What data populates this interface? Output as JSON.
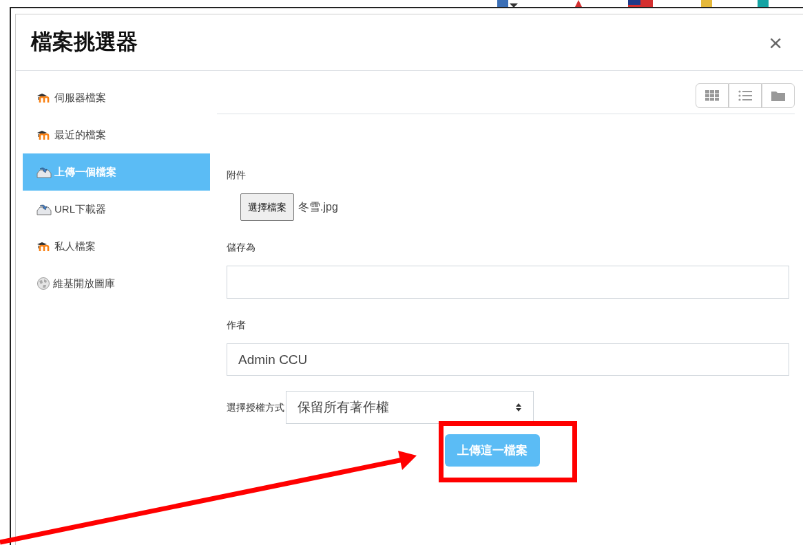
{
  "dialog": {
    "title": "檔案挑選器",
    "close": "×"
  },
  "sidebar": {
    "items": [
      {
        "label": "伺服器檔案",
        "kind": "moodle",
        "selected": false
      },
      {
        "label": "最近的檔案",
        "kind": "moodle",
        "selected": false
      },
      {
        "label": "上傳一個檔案",
        "kind": "upload",
        "selected": true
      },
      {
        "label": "URL下載器",
        "kind": "upload",
        "selected": false
      },
      {
        "label": "私人檔案",
        "kind": "moodle",
        "selected": false
      },
      {
        "label": "維基開放圖庫",
        "kind": "wiki",
        "selected": false
      }
    ]
  },
  "form": {
    "attachment_label": "附件",
    "choose_file_button": "選擇檔案",
    "file_name": "冬雪.jpg",
    "save_as_label": "儲存為",
    "author_label": "作者",
    "author_value": "Admin CCU",
    "license_label": "選擇授權方式",
    "license_value": "保留所有著作權",
    "upload_button": "上傳這一檔案"
  }
}
